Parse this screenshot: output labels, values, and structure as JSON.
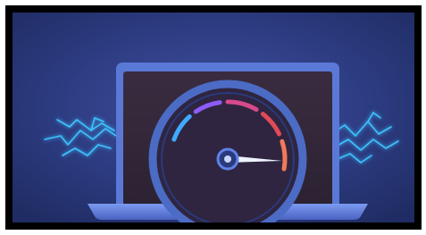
{
  "scene": {
    "subject": "laptop-speedometer-illustration",
    "icons": [
      "laptop-icon",
      "speedometer-gauge-icon",
      "lightning-bolt-icon"
    ],
    "gauge_level": 0.78,
    "colors": {
      "background": "#2a3a7c",
      "border": "#000000",
      "laptop_body": "#5a78d6",
      "screen": "#3a2a3e",
      "gauge_ring": "#3f5fb4",
      "gauge_red": "#e24a57",
      "gauge_purple": "#8b5cf6",
      "gauge_pink": "#d64a8c",
      "gauge_orange": "#f07a5a",
      "gauge_blue": "#3fa9ff",
      "lightning": "#3cc3ff",
      "needle": "#eef2ff"
    }
  }
}
